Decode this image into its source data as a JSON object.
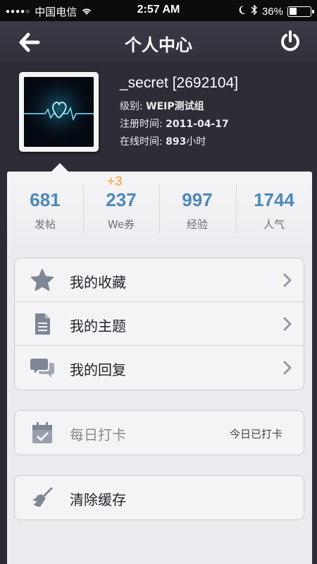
{
  "status_bar": {
    "signal": "●●●●○",
    "carrier": "中国电信",
    "time": "2:57 AM",
    "battery": "36%",
    "battery_level": 0.36
  },
  "nav": {
    "title": "个人中心",
    "back_icon": "back-arrow-icon",
    "power_icon": "power-icon"
  },
  "profile": {
    "name": "_secret [2692104]",
    "level_label": "级别: ",
    "level_value": "WEIP测试组",
    "register_label": "注册时间: ",
    "register_value": "2011-04-17",
    "online_label": "在线时间: ",
    "online_value": "893",
    "online_unit": "小时"
  },
  "stats": [
    {
      "value": "681",
      "label": "发帖"
    },
    {
      "value": "237",
      "label": "We券",
      "badge": "+3"
    },
    {
      "value": "997",
      "label": "经验"
    },
    {
      "value": "1744",
      "label": "人气"
    }
  ],
  "menu": {
    "favorites": "我的收藏",
    "topics": "我的主题",
    "replies": "我的回复"
  },
  "checkin": {
    "label": "每日打卡",
    "status": "今日已打卡"
  },
  "cache": {
    "label": "清除缓存"
  },
  "colors": {
    "accent": "#4f88b8",
    "badge": "#f5b36a",
    "header_bg": "#2c2d37"
  }
}
